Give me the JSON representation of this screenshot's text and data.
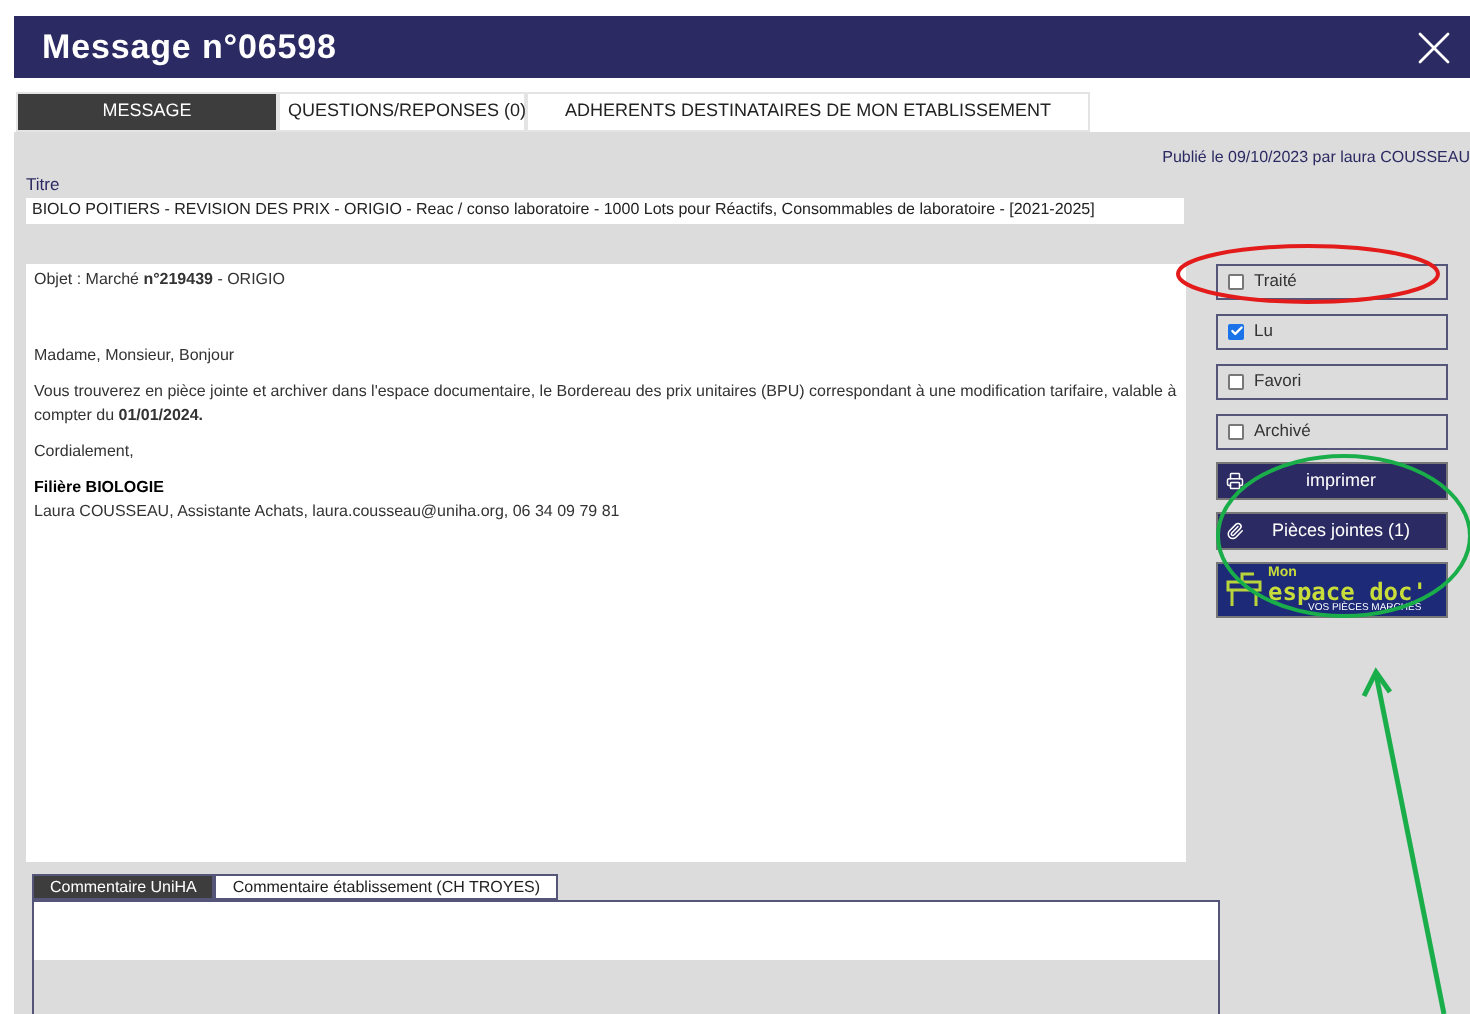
{
  "window": {
    "title": "Message n°06598"
  },
  "tabs": [
    {
      "label": "MESSAGE",
      "selected": true
    },
    {
      "label": "QUESTIONS/REPONSES (0)",
      "selected": false
    },
    {
      "label": "ADHERENTS DESTINATAIRES DE MON ETABLISSEMENT",
      "selected": false
    }
  ],
  "published": "Publié le 09/10/2023 par laura COUSSEAU",
  "title_field": {
    "label": "Titre",
    "value": "BIOLO POITIERS - REVISION DES PRIX - ORIGIO - Reac / conso laboratoire - 1000 Lots pour Réactifs, Consommables de laboratoire - [2021-2025]"
  },
  "message": {
    "subject": "Objet : Marché **n°219439** - ORIGIO",
    "paragraphs": [
      "Madame, Monsieur, Bonjour",
      "Vous trouverez en pièce jointe et archiver dans l'espace documentaire, le Bordereau des prix unitaires (BPU) correspondant à une modification tarifaire, valable à compter du **01/01/2024.**",
      "Cordialement,"
    ],
    "signature_title": "Filière BIOLOGIE",
    "signature_line": "Laura COUSSEAU, Assistante Achats, laura.cousseau@uniha.org, 06 34 09 79 81"
  },
  "flags": [
    {
      "label": "Traité",
      "checked": false
    },
    {
      "label": "Lu",
      "checked": true
    },
    {
      "label": "Favori",
      "checked": false
    },
    {
      "label": "Archivé",
      "checked": false
    }
  ],
  "actions": [
    {
      "kind": "print",
      "label": "imprimer"
    },
    {
      "kind": "attachment",
      "label": "Pièces jointes (1)"
    }
  ],
  "logo": {
    "top": "Mon",
    "main": "espace doc'",
    "sub": "VOS PIÈCES MARCHÉS"
  },
  "comment_tabs": [
    {
      "label": "Commentaire UniHA",
      "selected": true
    },
    {
      "label": "Commentaire établissement (CH TROYES)",
      "selected": false
    }
  ]
}
